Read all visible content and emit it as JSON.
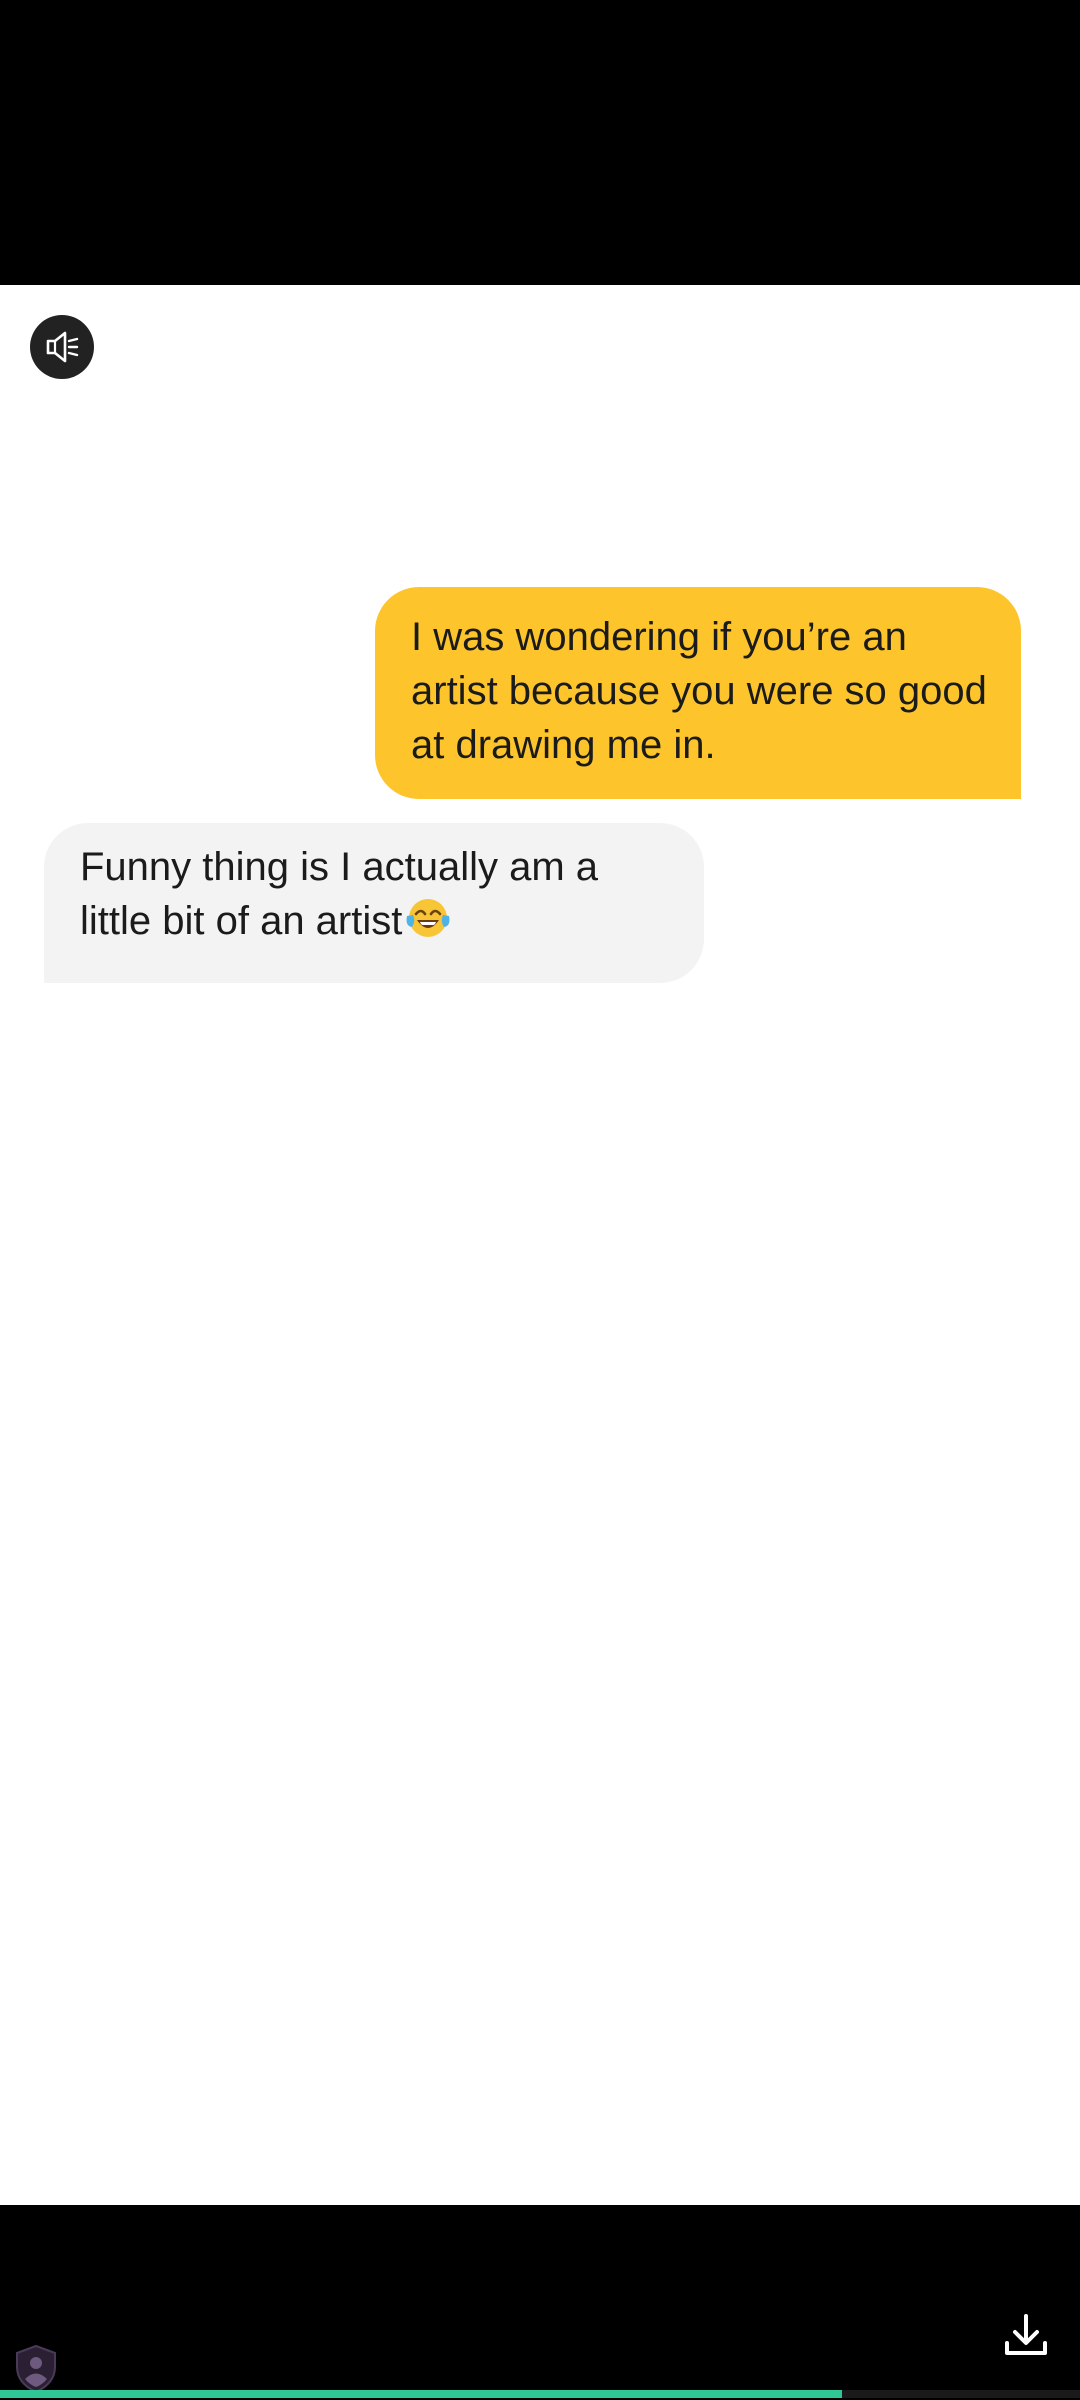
{
  "messages": [
    {
      "direction": "sent",
      "text": "I was wondering if you’re an artist because you were so good at drawing me in."
    },
    {
      "direction": "received",
      "text": "Funny thing is I actually am a little bit of an artist",
      "emoji": "face-with-tears-of-joy"
    }
  ],
  "controls": {
    "mute_icon": "speaker-muted-icon",
    "download_icon": "download-icon",
    "shield_icon": "privacy-shield-icon"
  },
  "playback": {
    "progress": 0.78
  },
  "colors": {
    "sent_bubble": "#fdc52b",
    "received_bubble": "#f3f3f3",
    "progress": "#2ec795",
    "letterbox": "#000000"
  }
}
